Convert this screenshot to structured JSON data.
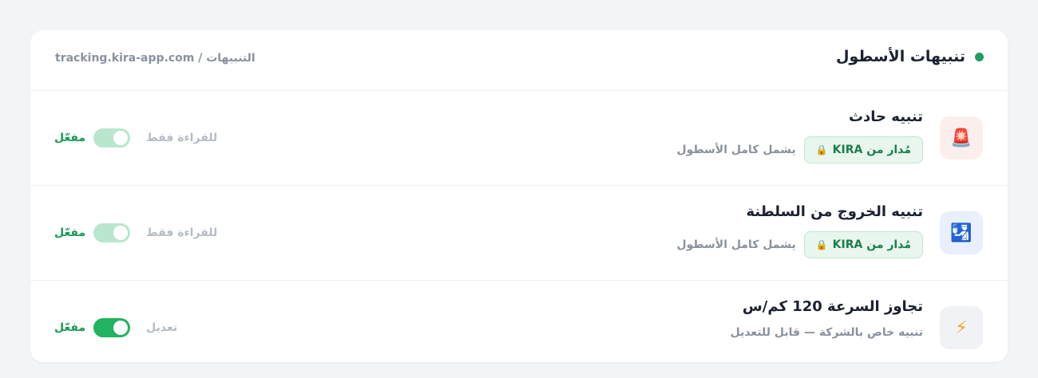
{
  "header": {
    "title": "تنبيهات الأسطول",
    "breadcrumb": "tracking.kira-app.com / التنبيهات"
  },
  "rows": [
    {
      "title": "تنبيه حادث",
      "icon": "🚨",
      "icon_name": "siren-icon",
      "badge": "مُدار من KIRA",
      "scope": "يشمل كامل الأسطول",
      "mode_label": "للقراءة فقط",
      "status_label": "مفعّل"
    },
    {
      "title": "تنبيه الخروج من السلطنة",
      "icon": "🛂",
      "icon_name": "border-exit-icon",
      "badge": "مُدار من KIRA",
      "scope": "يشمل كامل الأسطول",
      "mode_label": "للقراءة فقط",
      "status_label": "مفعّل"
    },
    {
      "title": "تجاوز السرعة 120 كم/س",
      "icon": "⚡",
      "icon_name": "lightning-icon",
      "subtitle": "تنبيه خاص بالشركة — قابل للتعديل",
      "mode_label": "تعديل",
      "status_label": "مفعّل"
    }
  ],
  "colors": {
    "accent": "#21b35f",
    "status_dot": "#1f9d63",
    "badge_text": "#1a7f4b",
    "readonly_toggle": "#b9e6cd"
  }
}
